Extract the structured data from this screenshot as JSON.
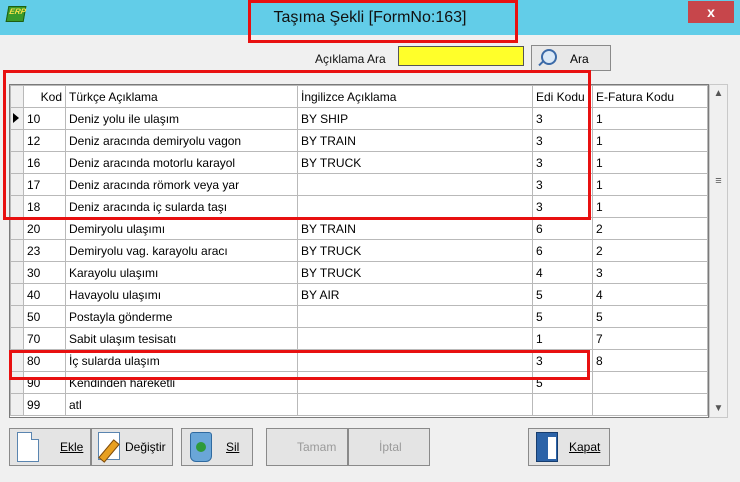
{
  "window": {
    "title": "Taşıma Şekli [FormNo:163]",
    "close_label": "x",
    "app_icon_text": "ERP"
  },
  "search": {
    "label": "Açıklama Ara",
    "value": "",
    "button_label": "Ara"
  },
  "table": {
    "headers": [
      "Kod",
      "Türkçe Açıklama",
      "İngilizce Açıklama",
      "Edi Kodu",
      "E-Fatura Kodu"
    ],
    "rows": [
      [
        "10",
        "Deniz yolu ile ulaşım",
        "BY SHIP",
        "3",
        "1"
      ],
      [
        "12",
        "Deniz aracında demiryolu vagon",
        "BY TRAIN",
        "3",
        "1"
      ],
      [
        "16",
        "Deniz aracında motorlu karayol",
        "BY TRUCK",
        "3",
        "1"
      ],
      [
        "17",
        "Deniz aracında römork veya yar",
        "",
        "3",
        "1"
      ],
      [
        "18",
        "Deniz aracında iç sularda taşı",
        "",
        "3",
        "1"
      ],
      [
        "20",
        "Demiryolu ulaşımı",
        "BY TRAIN",
        "6",
        "2"
      ],
      [
        "23",
        "Demiryolu vag. karayolu aracı",
        "BY TRUCK",
        "6",
        "2"
      ],
      [
        "30",
        "Karayolu ulaşımı",
        "BY TRUCK",
        "4",
        "3"
      ],
      [
        "40",
        "Havayolu ulaşımı",
        "BY AIR",
        "5",
        "4"
      ],
      [
        "50",
        "Postayla gönderme",
        "",
        "5",
        "5"
      ],
      [
        "70",
        "Sabit ulaşım tesisatı",
        "",
        "1",
        "7"
      ],
      [
        "80",
        "İç sularda ulaşım",
        "",
        "3",
        "8"
      ],
      [
        "90",
        "Kendinden hareketli",
        "",
        "5",
        ""
      ],
      [
        "99",
        "atl",
        "",
        "",
        ""
      ]
    ],
    "current_row": 0
  },
  "toolbar": {
    "add_label": "Ekle",
    "edit_label": "Değiştir",
    "delete_label": "Sil",
    "ok_label": "Tamam",
    "cancel_label": "İptal",
    "close_label": "Kapat"
  },
  "colors": {
    "search_bg": "#ffff2a",
    "highlight": "#e81010",
    "titlebar": "#62cde8",
    "close_button": "#c7464b"
  }
}
